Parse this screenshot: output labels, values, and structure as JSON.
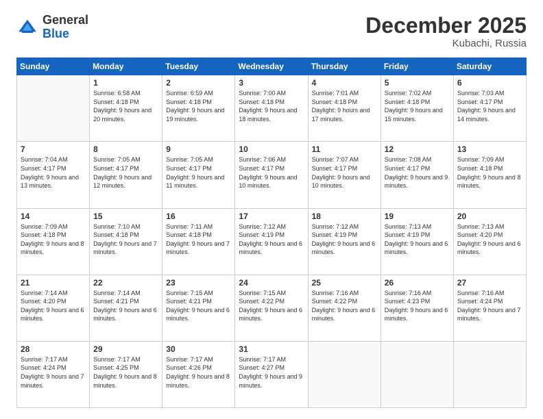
{
  "logo": {
    "general": "General",
    "blue": "Blue"
  },
  "header": {
    "month": "December 2025",
    "location": "Kubachi, Russia"
  },
  "weekdays": [
    "Sunday",
    "Monday",
    "Tuesday",
    "Wednesday",
    "Thursday",
    "Friday",
    "Saturday"
  ],
  "weeks": [
    [
      {
        "day": "",
        "sunrise": "",
        "sunset": "",
        "daylight": ""
      },
      {
        "day": "1",
        "sunrise": "6:58 AM",
        "sunset": "4:18 PM",
        "daylight": "9 hours and 20 minutes."
      },
      {
        "day": "2",
        "sunrise": "6:59 AM",
        "sunset": "4:18 PM",
        "daylight": "9 hours and 19 minutes."
      },
      {
        "day": "3",
        "sunrise": "7:00 AM",
        "sunset": "4:18 PM",
        "daylight": "9 hours and 18 minutes."
      },
      {
        "day": "4",
        "sunrise": "7:01 AM",
        "sunset": "4:18 PM",
        "daylight": "9 hours and 17 minutes."
      },
      {
        "day": "5",
        "sunrise": "7:02 AM",
        "sunset": "4:18 PM",
        "daylight": "9 hours and 15 minutes."
      },
      {
        "day": "6",
        "sunrise": "7:03 AM",
        "sunset": "4:17 PM",
        "daylight": "9 hours and 14 minutes."
      }
    ],
    [
      {
        "day": "7",
        "sunrise": "7:04 AM",
        "sunset": "4:17 PM",
        "daylight": "9 hours and 13 minutes."
      },
      {
        "day": "8",
        "sunrise": "7:05 AM",
        "sunset": "4:17 PM",
        "daylight": "9 hours and 12 minutes."
      },
      {
        "day": "9",
        "sunrise": "7:05 AM",
        "sunset": "4:17 PM",
        "daylight": "9 hours and 11 minutes."
      },
      {
        "day": "10",
        "sunrise": "7:06 AM",
        "sunset": "4:17 PM",
        "daylight": "9 hours and 10 minutes."
      },
      {
        "day": "11",
        "sunrise": "7:07 AM",
        "sunset": "4:17 PM",
        "daylight": "9 hours and 10 minutes."
      },
      {
        "day": "12",
        "sunrise": "7:08 AM",
        "sunset": "4:17 PM",
        "daylight": "9 hours and 9 minutes."
      },
      {
        "day": "13",
        "sunrise": "7:09 AM",
        "sunset": "4:18 PM",
        "daylight": "9 hours and 8 minutes."
      }
    ],
    [
      {
        "day": "14",
        "sunrise": "7:09 AM",
        "sunset": "4:18 PM",
        "daylight": "9 hours and 8 minutes."
      },
      {
        "day": "15",
        "sunrise": "7:10 AM",
        "sunset": "4:18 PM",
        "daylight": "9 hours and 7 minutes."
      },
      {
        "day": "16",
        "sunrise": "7:11 AM",
        "sunset": "4:18 PM",
        "daylight": "9 hours and 7 minutes."
      },
      {
        "day": "17",
        "sunrise": "7:12 AM",
        "sunset": "4:19 PM",
        "daylight": "9 hours and 6 minutes."
      },
      {
        "day": "18",
        "sunrise": "7:12 AM",
        "sunset": "4:19 PM",
        "daylight": "9 hours and 6 minutes."
      },
      {
        "day": "19",
        "sunrise": "7:13 AM",
        "sunset": "4:19 PM",
        "daylight": "9 hours and 6 minutes."
      },
      {
        "day": "20",
        "sunrise": "7:13 AM",
        "sunset": "4:20 PM",
        "daylight": "9 hours and 6 minutes."
      }
    ],
    [
      {
        "day": "21",
        "sunrise": "7:14 AM",
        "sunset": "4:20 PM",
        "daylight": "9 hours and 6 minutes."
      },
      {
        "day": "22",
        "sunrise": "7:14 AM",
        "sunset": "4:21 PM",
        "daylight": "9 hours and 6 minutes."
      },
      {
        "day": "23",
        "sunrise": "7:15 AM",
        "sunset": "4:21 PM",
        "daylight": "9 hours and 6 minutes."
      },
      {
        "day": "24",
        "sunrise": "7:15 AM",
        "sunset": "4:22 PM",
        "daylight": "9 hours and 6 minutes."
      },
      {
        "day": "25",
        "sunrise": "7:16 AM",
        "sunset": "4:22 PM",
        "daylight": "9 hours and 6 minutes."
      },
      {
        "day": "26",
        "sunrise": "7:16 AM",
        "sunset": "4:23 PM",
        "daylight": "9 hours and 6 minutes."
      },
      {
        "day": "27",
        "sunrise": "7:16 AM",
        "sunset": "4:24 PM",
        "daylight": "9 hours and 7 minutes."
      }
    ],
    [
      {
        "day": "28",
        "sunrise": "7:17 AM",
        "sunset": "4:24 PM",
        "daylight": "9 hours and 7 minutes."
      },
      {
        "day": "29",
        "sunrise": "7:17 AM",
        "sunset": "4:25 PM",
        "daylight": "9 hours and 8 minutes."
      },
      {
        "day": "30",
        "sunrise": "7:17 AM",
        "sunset": "4:26 PM",
        "daylight": "9 hours and 8 minutes."
      },
      {
        "day": "31",
        "sunrise": "7:17 AM",
        "sunset": "4:27 PM",
        "daylight": "9 hours and 9 minutes."
      },
      {
        "day": "",
        "sunrise": "",
        "sunset": "",
        "daylight": ""
      },
      {
        "day": "",
        "sunrise": "",
        "sunset": "",
        "daylight": ""
      },
      {
        "day": "",
        "sunrise": "",
        "sunset": "",
        "daylight": ""
      }
    ]
  ]
}
